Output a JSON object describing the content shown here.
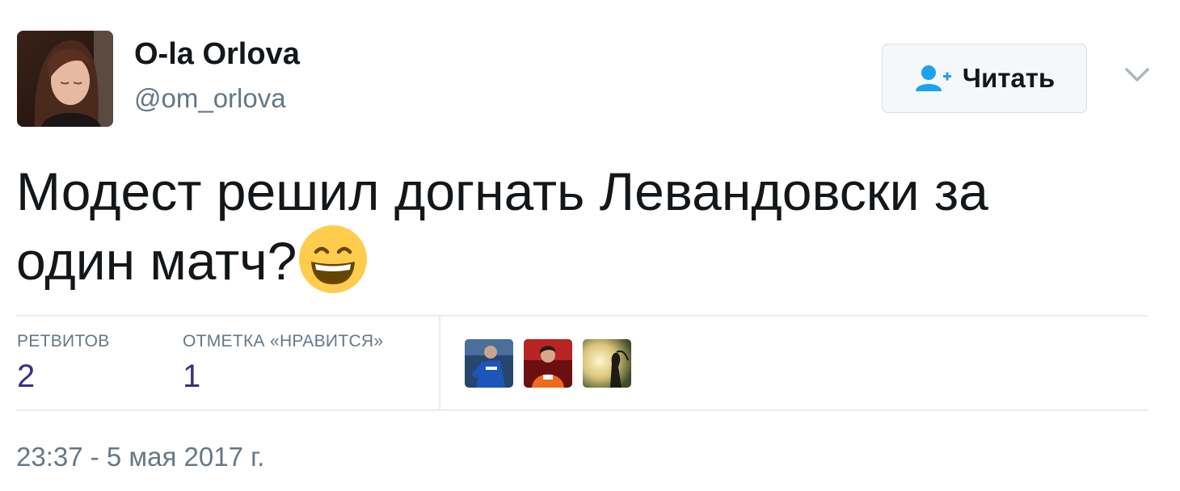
{
  "author": {
    "name": "O-la Orlova",
    "handle": "@om_orlova",
    "avatar_icon": "user-avatar-photo"
  },
  "follow_button": {
    "label": "Читать",
    "icon": "follow-person-plus-icon",
    "accent_color": "#1da1f2"
  },
  "menu": {
    "icon": "chevron-down-icon"
  },
  "tweet": {
    "text": "Модест решил догнать Левандовски за один матч?",
    "emoji": "grinning-face-with-smiling-eyes",
    "timestamp": "23:37 - 5 мая 2017 г."
  },
  "stats": {
    "retweets_label": "РЕТВИТОВ",
    "retweets_count": "2",
    "likes_label": "ОТМЕТКА «НРАВИТСЯ»",
    "likes_count": "1",
    "count_color": "#3b2f86"
  },
  "likers": [
    {
      "icon": "liker-avatar-football-player"
    },
    {
      "icon": "liker-avatar-orange-jersey"
    },
    {
      "icon": "liker-avatar-silhouette-sunset"
    }
  ]
}
